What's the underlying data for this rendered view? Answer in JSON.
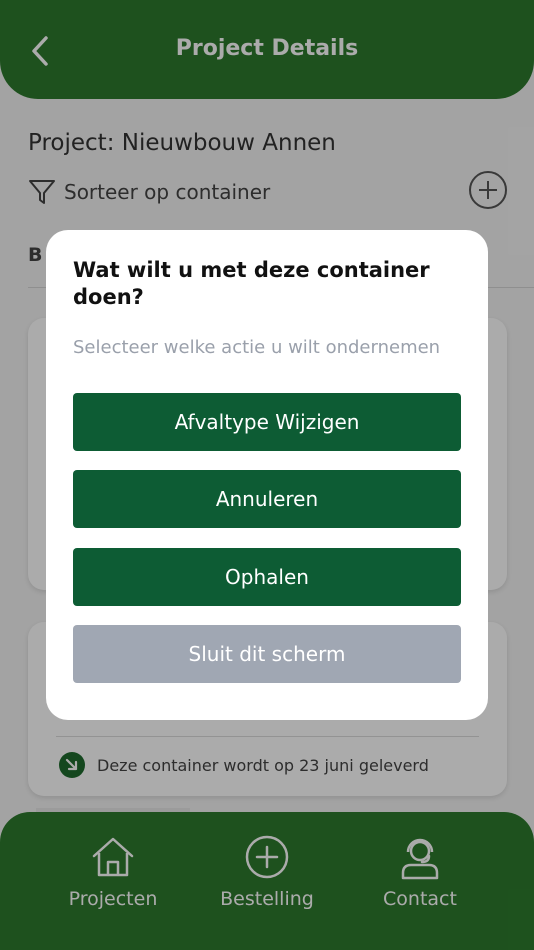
{
  "header": {
    "title": "Project Details",
    "back_icon": "chevron-left-icon"
  },
  "project": {
    "title": "Project: Nieuwbouw Annen"
  },
  "sort": {
    "label": "Sorteer op container",
    "icon": "filter-icon"
  },
  "section": {
    "label": "B"
  },
  "card2": {
    "delivery_text": "Deze container wordt op 23 juni geleverd",
    "icon": "arrow-down-right-icon"
  },
  "dialog": {
    "title": "Wat wilt u met deze container doen?",
    "subtitle": "Selecteer welke actie u wilt ondernemen",
    "buttons": {
      "change_waste_type": "Afvaltype Wijzigen",
      "cancel": "Annuleren",
      "pickup": "Ophalen",
      "close": "Sluit dit scherm"
    }
  },
  "nav": {
    "items": [
      {
        "label": "Projecten",
        "icon": "home-icon"
      },
      {
        "label": "Bestelling",
        "icon": "plus-circle-icon"
      },
      {
        "label": "Contact",
        "icon": "headset-icon"
      }
    ]
  },
  "colors": {
    "brand_green": "#2d7a2d",
    "button_green": "#0d5c34",
    "button_gray": "#a0a7b3"
  }
}
